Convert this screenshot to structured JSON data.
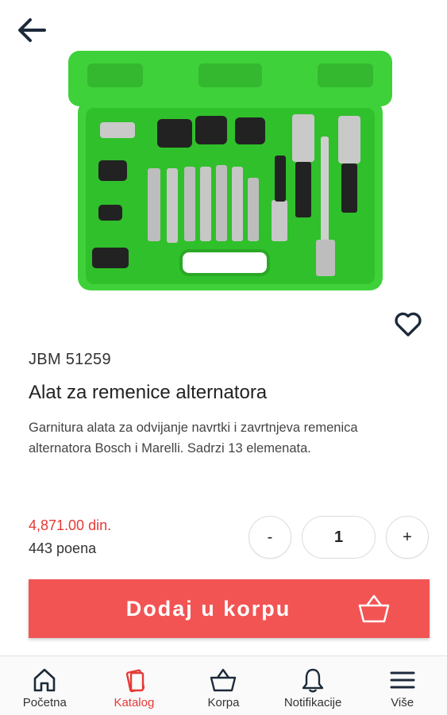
{
  "header": {
    "back_icon": "arrow-left-icon"
  },
  "product": {
    "sku": "JBM 51259",
    "title": "Alat za remenice alternatora",
    "description": "Garnitura alata za odvijanje navrtki i zavrtnjeva remenica alternatora Bosch i Marelli. Sadrzi 13 elemenata.",
    "price": "4,871.00 din.",
    "points": "443 poena",
    "favorite_icon": "heart-outline-icon"
  },
  "quantity": {
    "minus_label": "-",
    "value": "1",
    "plus_label": "+"
  },
  "cart_button": {
    "label": "Dodaj u korpu",
    "icon": "basket-icon"
  },
  "nav": {
    "items": [
      {
        "label": "Početna",
        "icon": "home-icon",
        "active": false
      },
      {
        "label": "Katalog",
        "icon": "catalog-icon",
        "active": true
      },
      {
        "label": "Korpa",
        "icon": "basket-icon",
        "active": false
      },
      {
        "label": "Notifikacije",
        "icon": "bell-icon",
        "active": false
      },
      {
        "label": "Više",
        "icon": "menu-icon",
        "active": false
      }
    ]
  },
  "colors": {
    "accent": "#e53935",
    "button": "#f25454",
    "case_green": "#3fd13a"
  }
}
